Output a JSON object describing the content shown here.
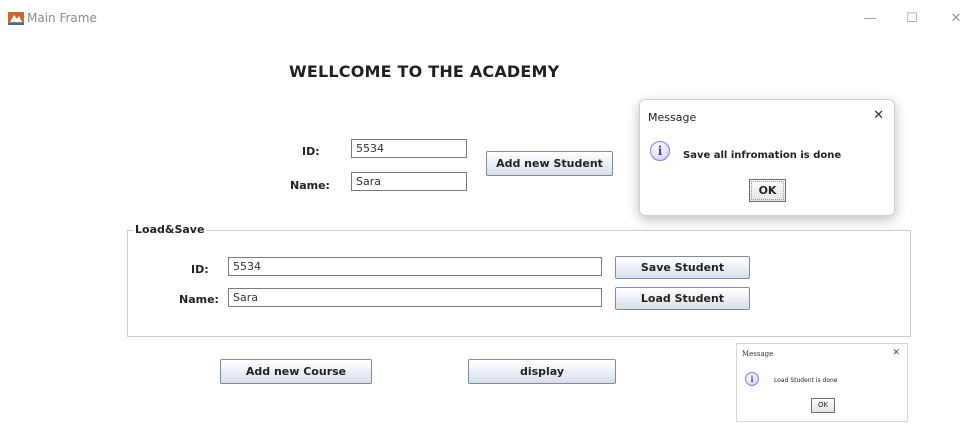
{
  "window": {
    "title": "Main Frame",
    "controls": {
      "minimize": "—",
      "maximize": "☐",
      "close": "✕"
    }
  },
  "heading": "WELLCOME TO THE ACADEMY",
  "top_form": {
    "id_label": "ID:",
    "id_value": "5534",
    "name_label": "Name:",
    "name_value": "Sara",
    "add_student_button": "Add new Student"
  },
  "load_save": {
    "title": "Load&Save",
    "id_label": "ID:",
    "id_value": "5534",
    "name_label": "Name:",
    "name_value": "Sara",
    "save_button": "Save Student",
    "load_button": "Load Student"
  },
  "bottom_buttons": {
    "add_course": "Add new Course",
    "display": "display"
  },
  "dialogs": [
    {
      "title": "Message",
      "message": "Save all infromation is done",
      "ok": "OK",
      "close": "✕",
      "icon": "info-icon"
    },
    {
      "title": "Message",
      "message": "Load Student is done",
      "ok": "OK",
      "close": "✕",
      "icon": "info-icon"
    }
  ]
}
